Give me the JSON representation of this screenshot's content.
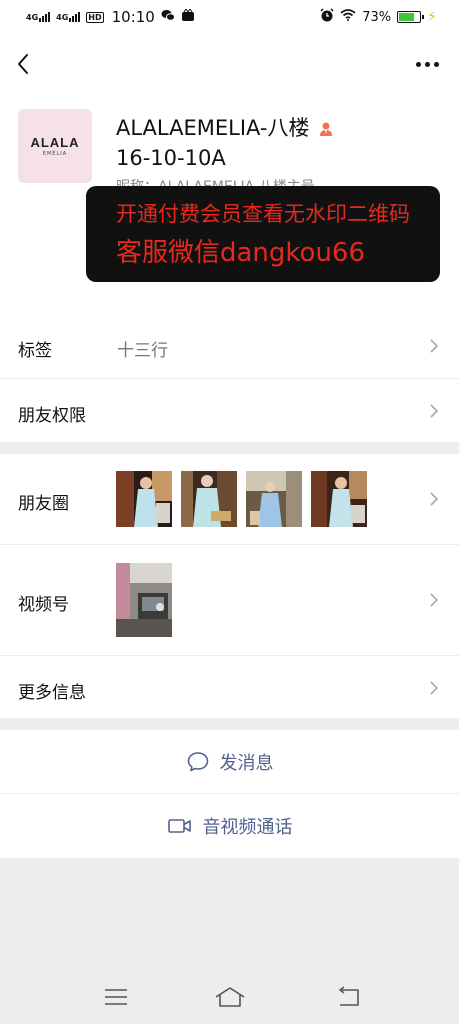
{
  "status_bar": {
    "net1": "4G",
    "net2": "4G",
    "hd": "HD",
    "time": "10:10",
    "battery_pct": "73%",
    "battery_level": 0.73,
    "colors": {
      "battery": "#3cc63c",
      "bolt": "#f2c200"
    }
  },
  "nav": {
    "back_icon": "chevron-left-icon",
    "more_icon": "ellipsis-icon"
  },
  "profile": {
    "avatar_brand": "ALALA",
    "avatar_sub": "EMÉLIA",
    "name": "ALALAEMELIA-八楼",
    "name_line2": "16-10-10A",
    "nickname": "昵称：ALALAEMELIA 八楼主号"
  },
  "watermark": {
    "line1": "开通付费会员查看无水印二维码",
    "line2": "客服微信dangkou66",
    "color": "#e8281e"
  },
  "rows": {
    "tags_label": "标签",
    "tags_value": "十三行",
    "permissions_label": "朋友权限",
    "moments_label": "朋友圈",
    "channels_label": "视频号",
    "more_info_label": "更多信息"
  },
  "actions": {
    "message_label": "发消息",
    "call_label": "音视频通话",
    "color": "#51628e"
  },
  "system_nav": {
    "menu_icon": "menu-icon",
    "home_icon": "home-icon",
    "back_icon": "back-icon"
  }
}
